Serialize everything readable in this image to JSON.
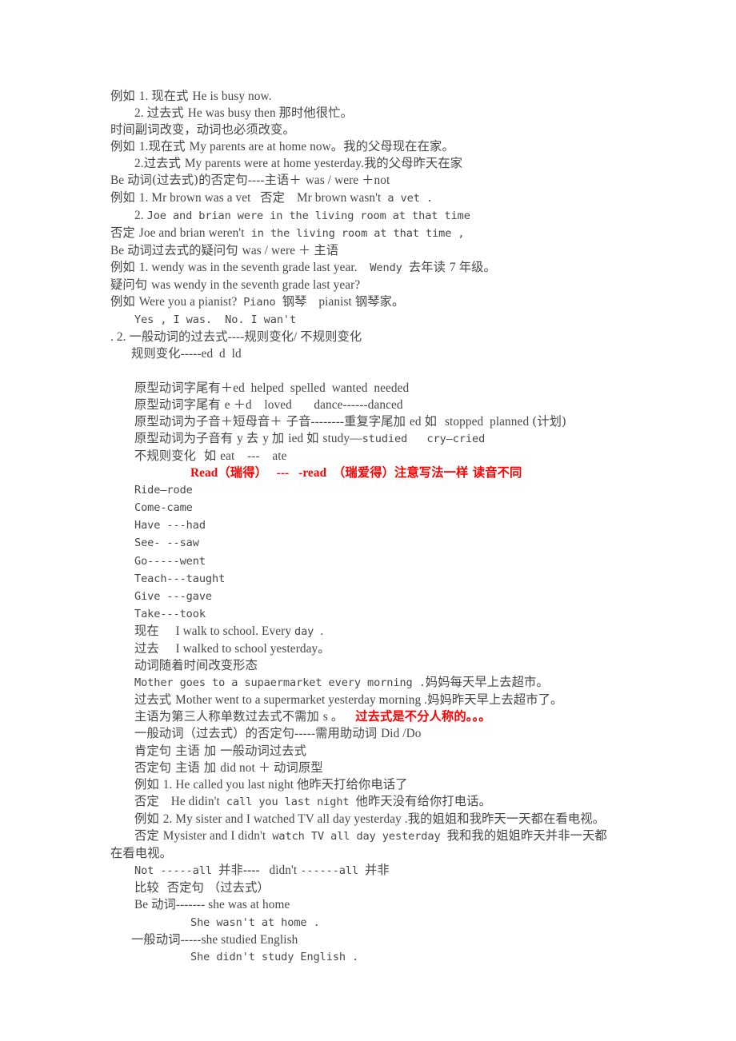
{
  "document": {
    "title_implicit": "一般过去式语法笔记",
    "text_color": "#474747",
    "highlight_color": "#ff0000",
    "background": "#ffffff",
    "lines": [
      {
        "id": "l1",
        "indent": 0,
        "text": "例如 1. 现在式 He is busy now."
      },
      {
        "id": "l2",
        "indent": 2,
        "text": "2. 过去式 He was busy then 那时他很忙。"
      },
      {
        "id": "l3",
        "indent": 0,
        "text": "时间副词改变，动词也必须改变。"
      },
      {
        "id": "l4",
        "indent": 0,
        "text": "例如 1.现在式 My parents are at home now。我的父母现在在家。"
      },
      {
        "id": "l5",
        "indent": 2,
        "text": "2.过去式 My parents were at home yesterday.我的父母昨天在家"
      },
      {
        "id": "l6",
        "indent": 0,
        "text": "Be 动词(过去式)的否定句----主语＋ was / were ＋not"
      },
      {
        "id": "l7",
        "indent": 0,
        "text": "例如 1. Mr brown was a vet  否定  Mr brown wasn't a vet ."
      },
      {
        "id": "l8",
        "indent": 2,
        "text": "2. Joe and brian were in the living room at that time"
      },
      {
        "id": "l9",
        "indent": 0,
        "text": "否定 Joe and brian weren't in the living room at that time ,"
      },
      {
        "id": "l10",
        "indent": 0,
        "text": "Be 动词过去式的疑问句 was / were ＋ 主语"
      },
      {
        "id": "l11",
        "indent": 0,
        "text": "例如 1. wendy was in the seventh grade last year.    Wendy 去年读 7 年级。"
      },
      {
        "id": "l12",
        "indent": 0,
        "text": "疑问句 was wendy in the seventh grade last year?"
      },
      {
        "id": "l13",
        "indent": 0,
        "text": "例如 Were you a pianist?  Piano 钢琴  pianist 钢琴家。"
      },
      {
        "id": "l14",
        "indent": 2,
        "text": "Yes , I was.  No. I wan't"
      },
      {
        "id": "l15",
        "indent": 0,
        "text": ". 2. 一般动词的过去式----规则变化/ 不规则变化"
      },
      {
        "id": "l16",
        "indent": 1,
        "text": "规则变化-----ed  d  ld"
      },
      {
        "id": "l17",
        "indent": 2,
        "text": "原型动词字尾有＋ed  helped  spelled  wanted  needed"
      },
      {
        "id": "l18",
        "indent": 2,
        "text": "原型动词字尾有 e ＋d   loved      dance------danced"
      },
      {
        "id": "l19",
        "indent": 2,
        "text": "原型动词为子音＋短母音＋ 子音--------重复字尾加 ed 如  stopped  planned (计划)"
      },
      {
        "id": "l20",
        "indent": 2,
        "text": "原型动词为子音有 y 去 y 加 ied 如 study—studied   cry—cried"
      },
      {
        "id": "l21",
        "indent": 2,
        "text": "不规则变化  如 eat   ---   ate"
      },
      {
        "id": "l22",
        "indent": 4,
        "text": "Read（瑞得）  ---  -read （瑞爱得）注意写法一样 读音不同",
        "color": "red"
      },
      {
        "id": "l23",
        "indent": 2,
        "text": "Ride—rode"
      },
      {
        "id": "l24",
        "indent": 2,
        "text": "Come-came"
      },
      {
        "id": "l25",
        "indent": 2,
        "text": "Have ---had"
      },
      {
        "id": "l26",
        "indent": 2,
        "text": "See- --saw"
      },
      {
        "id": "l27",
        "indent": 2,
        "text": "Go-----went"
      },
      {
        "id": "l28",
        "indent": 2,
        "text": "Teach---taught"
      },
      {
        "id": "l29",
        "indent": 2,
        "text": "Give ---gave"
      },
      {
        "id": "l30",
        "indent": 2,
        "text": "Take---took"
      },
      {
        "id": "l31",
        "indent": 2,
        "text": "现在    I walk to school. Every day ."
      },
      {
        "id": "l32",
        "indent": 2,
        "text": "过去    I walked to school yesterday。"
      },
      {
        "id": "l33",
        "indent": 2,
        "text": "动词随着时间改变形态"
      },
      {
        "id": "l34",
        "indent": 2,
        "text": "Mother goes to a supaermarket every morning .妈妈每天早上去超市。"
      },
      {
        "id": "l35",
        "indent": 2,
        "text": "过去式 Mother went to a supermarket yesterday morning .妈妈昨天早上去超市了。"
      },
      {
        "id": "l36",
        "indent": 2,
        "text": "主语为第三人称单数过去式不需加 s 。",
        "trailing_red": "过去式是不分人称的。。。"
      },
      {
        "id": "l37",
        "indent": 2,
        "text": "一般动词（过去式）的否定句-----需用助动词 Did /Do"
      },
      {
        "id": "l38",
        "indent": 2,
        "text": "肯定句 主语 加 一般动词过去式"
      },
      {
        "id": "l39",
        "indent": 2,
        "text": "否定句 主语 加 did not ＋ 动词原型"
      },
      {
        "id": "l40",
        "indent": 2,
        "text": "例如 1. He called you last night 他昨天打给你电话了"
      },
      {
        "id": "l41",
        "indent": 2,
        "text": "否定  He didin't call you last night 他昨天没有给你打电话。"
      },
      {
        "id": "l42",
        "indent": 2,
        "text": "例如 2. My sister and I watched TV all day yesterday .我的姐姐和我昨天一天都在看电视。"
      },
      {
        "id": "l43",
        "indent": 2,
        "text": "否定 Mysister and I didn't watch TV all day yesterday 我和我的姐姐昨天并非一天都"
      },
      {
        "id": "l44",
        "indent": 0,
        "text": "在看电视。"
      },
      {
        "id": "l45",
        "indent": 2,
        "text": "Not -----all 并非----  didn't ------all 并非"
      },
      {
        "id": "l46",
        "indent": 2,
        "text": "比较  否定句 （过去式）"
      },
      {
        "id": "l47",
        "indent": 2,
        "text": "Be 动词------- she was at home"
      },
      {
        "id": "l48",
        "indent": 4,
        "text": "She wasn't at home ."
      },
      {
        "id": "l49",
        "indent": 1,
        "text": "一般动词-----she studied English"
      },
      {
        "id": "l50",
        "indent": 4,
        "text": "She didn't study English ."
      }
    ]
  }
}
